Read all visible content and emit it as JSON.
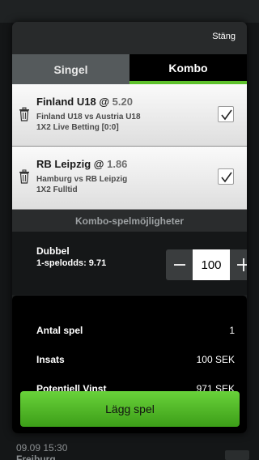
{
  "sheet": {
    "close_label": "Stäng",
    "tabs": [
      {
        "label": "Singel",
        "active": false
      },
      {
        "label": "Kombo",
        "active": true
      }
    ],
    "bets": [
      {
        "team": "Finland U18",
        "at": "@",
        "odds": "5.20",
        "match": "Finland U18 vs Austria U18",
        "market": "1X2 Live Betting [0:0]",
        "checked": true
      },
      {
        "team": "RB Leipzig",
        "at": "@",
        "odds": "1.86",
        "match": "Hamburg vs RB Leipzig",
        "market": "1X2 Fulltid",
        "checked": true
      }
    ],
    "combo_section_title": "Kombo-spelmöjligheter",
    "combo": {
      "name": "Dubbel",
      "odds_label": "1-spelodds:",
      "odds_value": "9.71",
      "stake": "100"
    },
    "summary": {
      "rows": [
        {
          "label": "Antal spel",
          "value": "1"
        },
        {
          "label": "Insats",
          "value": "100 SEK"
        },
        {
          "label": "Potentiell Vinst",
          "value": "971 SEK"
        }
      ]
    },
    "place_bet_label": "Lägg spel"
  },
  "background": {
    "date": "09.09 15:30",
    "team": "Freiburg"
  },
  "colors": {
    "accent": "#5ec12c",
    "sheet_bg": "#1d1f20",
    "button_green": "#4fb823"
  },
  "icons": [
    "trash-icon",
    "checkmark-icon",
    "minus-icon",
    "plus-icon"
  ]
}
